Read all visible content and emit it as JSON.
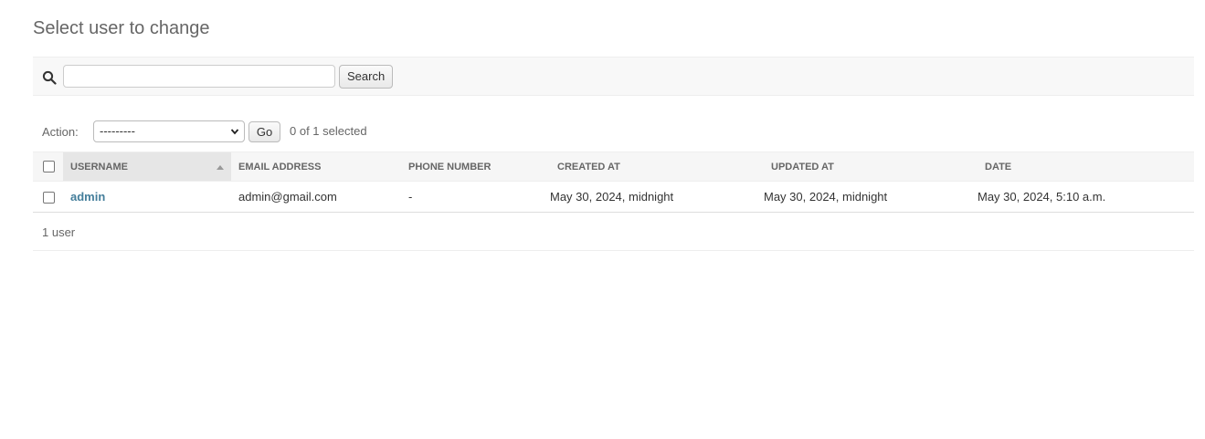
{
  "page": {
    "title": "Select user to change"
  },
  "search": {
    "value": "",
    "placeholder": "",
    "button_label": "Search"
  },
  "actions": {
    "label": "Action:",
    "selected_option": "---------",
    "go_label": "Go",
    "counter": "0 of 1 selected"
  },
  "table": {
    "columns": [
      {
        "label": "Username",
        "sorted": true
      },
      {
        "label": "Email address"
      },
      {
        "label": "Phone number"
      },
      {
        "label": "Created at"
      },
      {
        "label": "Updated at"
      },
      {
        "label": "Date"
      }
    ],
    "rows": [
      {
        "username": "admin",
        "email": "admin@gmail.com",
        "phone": "-",
        "created_at": "May 30, 2024, midnight",
        "updated_at": "May 30, 2024, midnight",
        "date": "May 30, 2024, 5:10 a.m."
      }
    ]
  },
  "paginator": {
    "text": "1 user"
  },
  "colors": {
    "link": "#447e9b",
    "toolbar_bg": "#f8f8f8",
    "header_bg": "#f6f6f6",
    "sorted_header_bg": "#e6e6e6"
  },
  "icons": {
    "search": "search-icon",
    "sort": "sort-ascending-icon",
    "dropdown": "chevron-down-icon"
  }
}
